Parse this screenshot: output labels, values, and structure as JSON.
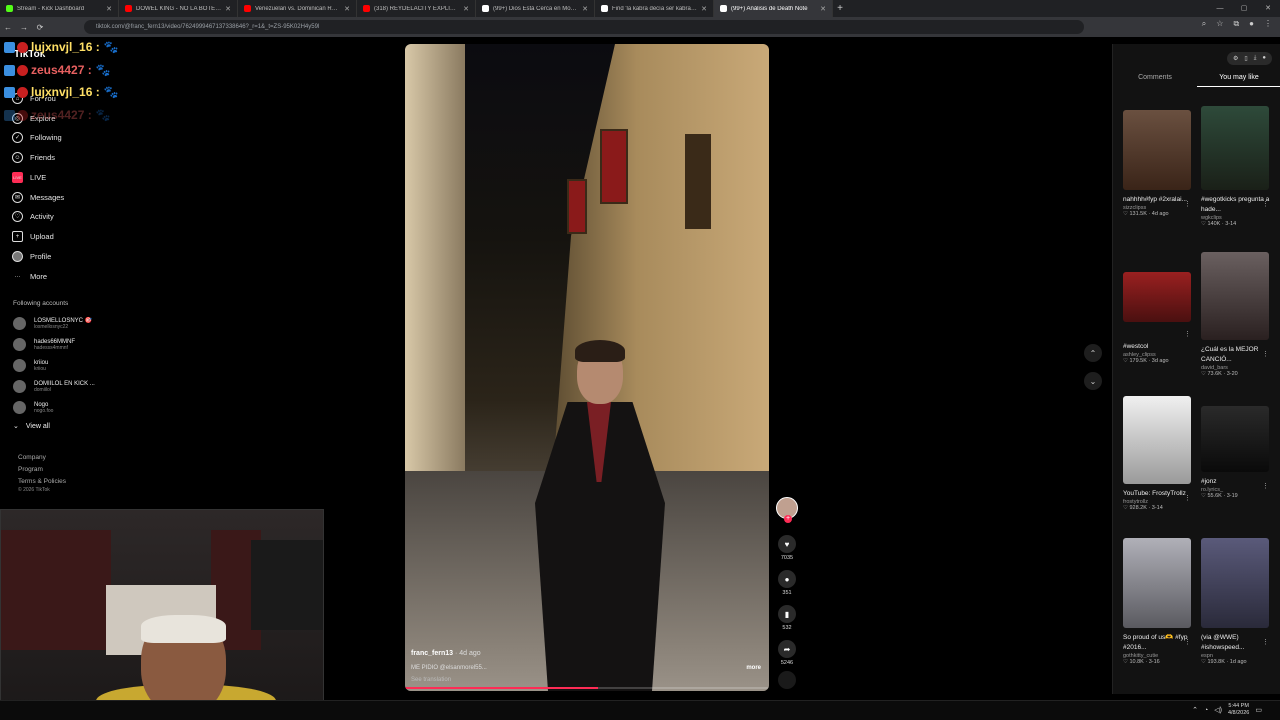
{
  "tabs": [
    {
      "label": "Stream - Kick Dashboard",
      "color": "#53fc18",
      "active": false
    },
    {
      "label": "DOWEL KING - NO LA BOTE | VIDA",
      "color": "#ff0000",
      "active": false
    },
    {
      "label": "Venezuelan vs. Dominican Reput",
      "color": "#ff0000",
      "active": false
    },
    {
      "label": "(318) REYDELACITY EXPLICA POR",
      "color": "#ff0000",
      "active": false
    },
    {
      "label": "(99+) Dios Está Cerca en Momen",
      "color": "#ffffff",
      "active": false
    },
    {
      "label": "Find 'la kabra decía ser kabra' on",
      "color": "#ffffff",
      "active": false
    },
    {
      "label": "(99+) Análisis de Death Note",
      "color": "#ffffff",
      "active": true
    }
  ],
  "new_tab": "+",
  "window_controls": {
    "min": "—",
    "max": "▢",
    "close": "✕"
  },
  "url": "tiktok.com/@franc_fern13/video/7624999467137338646?_r=1&_t=ZS-95K02H4y59l",
  "chat": [
    {
      "user": "lujxnvjl_16 :",
      "emote": "🐾",
      "color": "yellow"
    },
    {
      "user": "zeus4427 :",
      "emote": "🐾",
      "color": "red"
    },
    {
      "user": "lujxnvjl_16 :",
      "emote": "🐾",
      "color": "yellow"
    },
    {
      "user": "zeus4427 :",
      "emote": "🐾",
      "color": "red"
    }
  ],
  "sidebar": {
    "logo": "TikTok",
    "items": [
      {
        "label": "For You",
        "icon": "home-icon"
      },
      {
        "label": "Explore",
        "icon": "compass-icon"
      },
      {
        "label": "Following",
        "icon": "following-icon"
      },
      {
        "label": "Friends",
        "icon": "friends-icon"
      },
      {
        "label": "LIVE",
        "icon": "live-icon"
      },
      {
        "label": "Messages",
        "icon": "messages-icon"
      },
      {
        "label": "Activity",
        "icon": "activity-icon"
      },
      {
        "label": "Upload",
        "icon": "upload-icon"
      },
      {
        "label": "Profile",
        "icon": "profile-icon"
      },
      {
        "label": "More",
        "icon": "more-icon"
      }
    ],
    "following_title": "Following accounts",
    "accounts": [
      {
        "name": "LOSMELLOSNYC 🎯",
        "handle": "losmellosnyc22"
      },
      {
        "name": "hades66MMNF",
        "handle": "hadesss4mmnf"
      },
      {
        "name": "kriiou",
        "handle": "kriiou"
      },
      {
        "name": "DOMIILOL EN KICK ...",
        "handle": "domiilol"
      },
      {
        "name": "Nogo",
        "handle": "nogo.foo"
      }
    ],
    "view_all": "View all",
    "footer": [
      "Company",
      "Program",
      "Terms & Policies"
    ],
    "copyright": "© 2026 TikTok"
  },
  "video": {
    "user": "franc_fern13",
    "ago": "· 4d ago",
    "caption": "ME PIDIO @elsanmorel55...",
    "more": "more",
    "translate": "See translation",
    "progress": 0.53
  },
  "actions": {
    "likes": "7035",
    "comments": "351",
    "saves": "532",
    "shares": "5246"
  },
  "right_panel": {
    "tabs": [
      "Comments",
      "You may like"
    ],
    "active_tab": 1,
    "cards": [
      {
        "title": "nahhhh#fyp #2xralai...",
        "author": "sizzclipss",
        "stats": "♡ 131.5K · 4d ago",
        "thumb": "#5a4030"
      },
      {
        "title": "#wegotkicks pregunta a hade...",
        "author": "wgkclips",
        "stats": "♡ 140K · 3-14",
        "thumb": "#2e3a30"
      },
      {
        "title": "#westcol",
        "author": "ashley_clipss",
        "stats": "♡ 179.5K · 3d ago",
        "thumb": "#7a1818"
      },
      {
        "title": "¿Cuál es la MEJOR CANCIÓ...",
        "author": "david_bars",
        "stats": "♡ 73.6K · 3-20",
        "thumb": "#4a4040"
      },
      {
        "title": "YouTube: FrostyTrollz",
        "author": "frostytrollz",
        "stats": "♡ 928.2K · 3-14",
        "thumb": "#d8d8d8"
      },
      {
        "title": "#jonz",
        "author": "ro.lyrics_",
        "stats": "♡ 55.6K · 3-19",
        "thumb": "#1a1a1a"
      },
      {
        "title": "So proud of us🫶 #fyp #2016...",
        "author": "gothkitty_cutie",
        "stats": "♡ 10.8K · 3-16",
        "thumb": "#8a8a90"
      },
      {
        "title": "(via @WWE) #ishowspeed...",
        "author": "espn",
        "stats": "♡ 193.8K · 1d ago",
        "thumb": "#3a3a50"
      }
    ]
  },
  "taskbar": {
    "time": "5:44 PM",
    "date": "4/8/2026"
  }
}
